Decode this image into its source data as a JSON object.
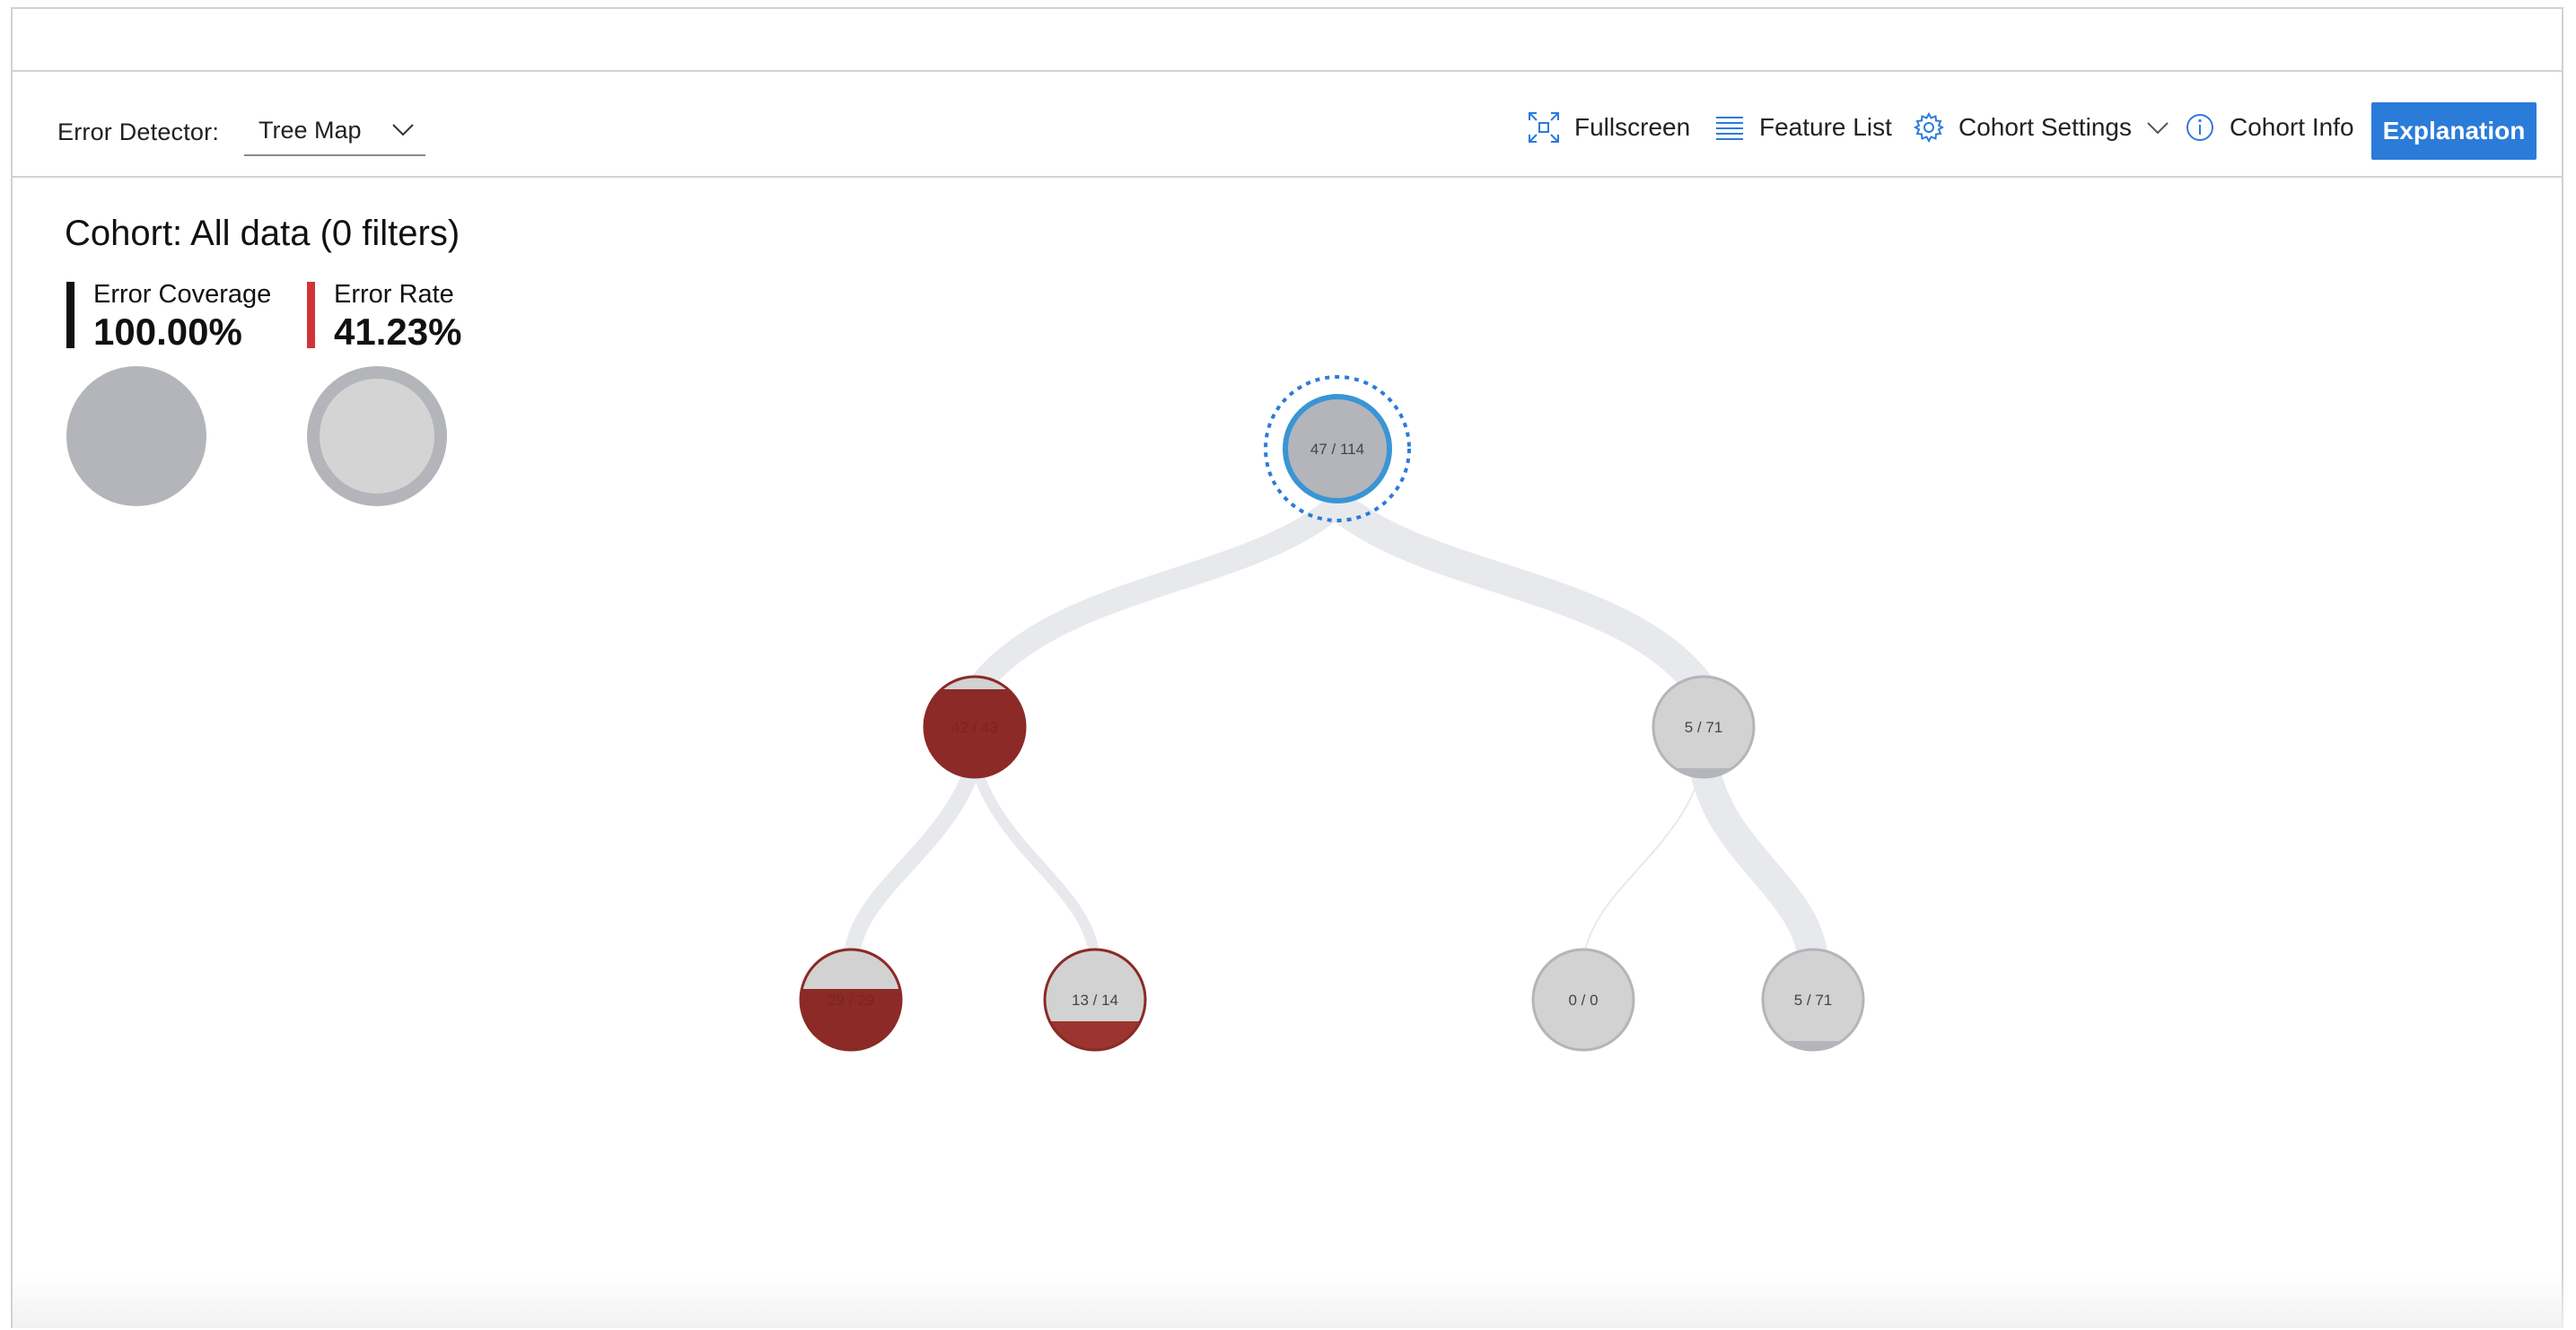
{
  "toolbar": {
    "detector_label": "Error Detector:",
    "detector_value": "Tree Map",
    "fullscreen_label": "Fullscreen",
    "feature_list_label": "Feature List",
    "cohort_settings_label": "Cohort Settings",
    "cohort_info_label": "Cohort Info",
    "explanation_label": "Explanation"
  },
  "cohort": {
    "title": "Cohort: All data (0 filters)",
    "error_coverage_label": "Error Coverage",
    "error_coverage_value": "100.00%",
    "error_rate_label": "Error Rate",
    "error_rate_value": "41.23%"
  },
  "tree": {
    "nodes": [
      {
        "id": "root",
        "label": "47 / 114",
        "selected": true,
        "error_fraction": 0.41
      },
      {
        "id": "left",
        "label": "42 / 43",
        "selected": false,
        "error_fraction": 0.98
      },
      {
        "id": "right",
        "label": "5 / 71",
        "selected": false,
        "error_fraction": 0.07
      },
      {
        "id": "left-left",
        "label": "29 / 29",
        "selected": false,
        "error_fraction": 1.0
      },
      {
        "id": "left-right",
        "label": "13 / 14",
        "selected": false,
        "error_fraction": 0.93
      },
      {
        "id": "right-left",
        "label": "0 / 0",
        "selected": false,
        "error_fraction": 0.0
      },
      {
        "id": "right-right",
        "label": "5 / 71",
        "selected": false,
        "error_fraction": 0.07
      }
    ]
  },
  "colors": {
    "accent": "#2b7bd9",
    "error_red": "#8b2a26",
    "node_gray": "#b3b5ba",
    "node_light": "#d2d2d2",
    "link_gray": "#e8e9ec"
  }
}
